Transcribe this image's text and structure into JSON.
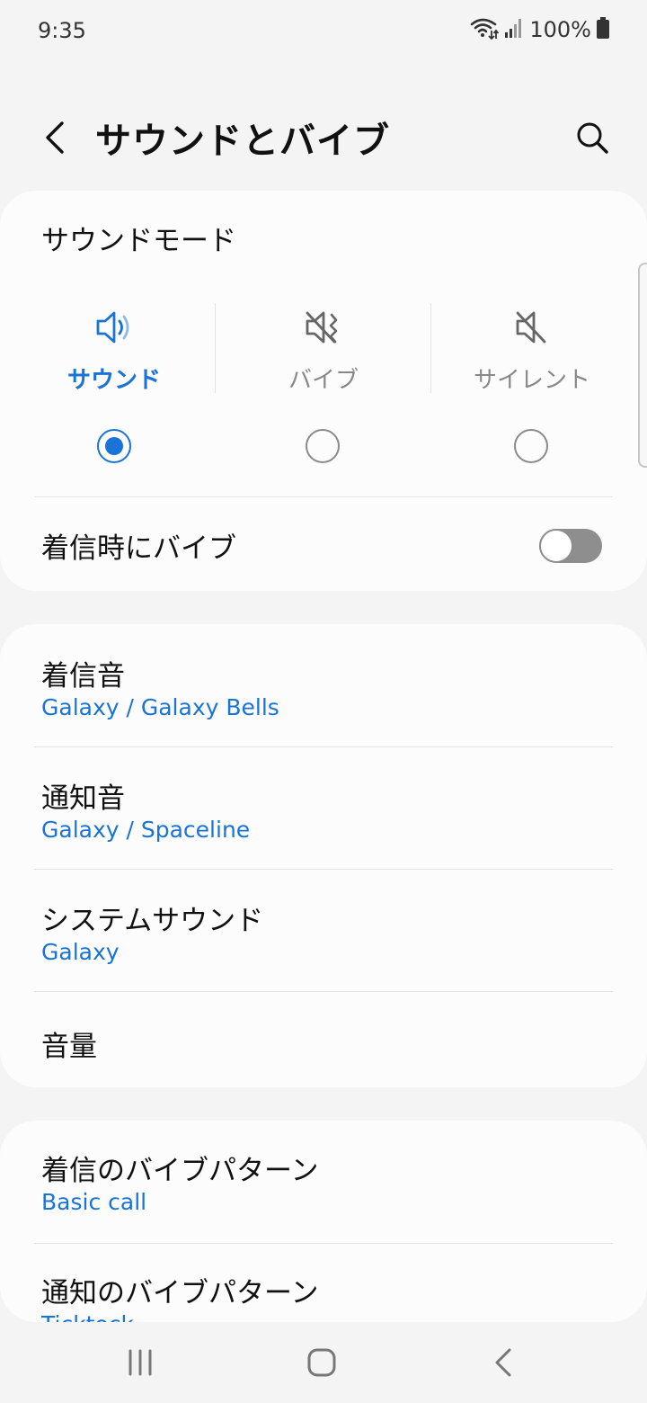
{
  "status": {
    "time": "9:35",
    "battery": "100%",
    "icons": [
      "wifi-icon",
      "signal-icon",
      "battery-icon"
    ]
  },
  "header": {
    "title": "サウンドとバイブ",
    "back_icon": "back-arrow-icon",
    "search_icon": "search-icon"
  },
  "sound_mode": {
    "title": "サウンドモード",
    "modes": [
      {
        "label": "サウンド",
        "icon": "speaker-icon",
        "selected": true
      },
      {
        "label": "バイブ",
        "icon": "vibrate-icon",
        "selected": false
      },
      {
        "label": "サイレント",
        "icon": "mute-icon",
        "selected": false
      }
    ],
    "vibrate_on_call": {
      "label": "着信時にバイブ",
      "enabled": false
    }
  },
  "sounds": [
    {
      "title": "着信音",
      "value": "Galaxy / Galaxy Bells"
    },
    {
      "title": "通知音",
      "value": "Galaxy / Spaceline"
    },
    {
      "title": "システムサウンド",
      "value": "Galaxy"
    },
    {
      "title": "音量"
    }
  ],
  "vibration": [
    {
      "title": "着信のバイブパターン",
      "value": "Basic call"
    },
    {
      "title": "通知のバイブパターン",
      "value": "Ticktock"
    }
  ],
  "colors": {
    "accent": "#1a73d6",
    "background": "#f4f4f4",
    "card": "#fcfcfc"
  },
  "navbar": {
    "icons": [
      "recent-apps-icon",
      "home-icon",
      "back-icon"
    ]
  }
}
